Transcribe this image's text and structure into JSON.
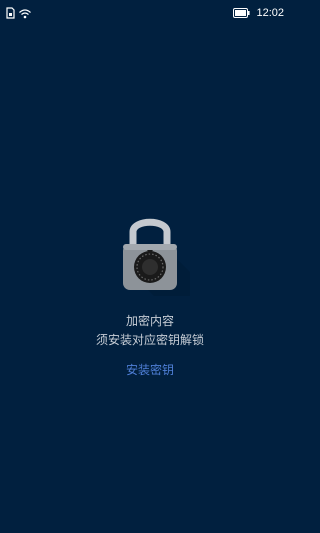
{
  "status_bar": {
    "time": "12:02",
    "icons": [
      "sim-card-icon",
      "wifi-icon",
      "battery-icon"
    ]
  },
  "lock_screen": {
    "icon": "padlock-icon",
    "title": "加密内容",
    "subtitle": "须安装对应密钥解锁",
    "action_label": "安装密钥"
  },
  "colors": {
    "background": "#01203f",
    "text": "#c8ced6",
    "link": "#4f7fd7"
  }
}
